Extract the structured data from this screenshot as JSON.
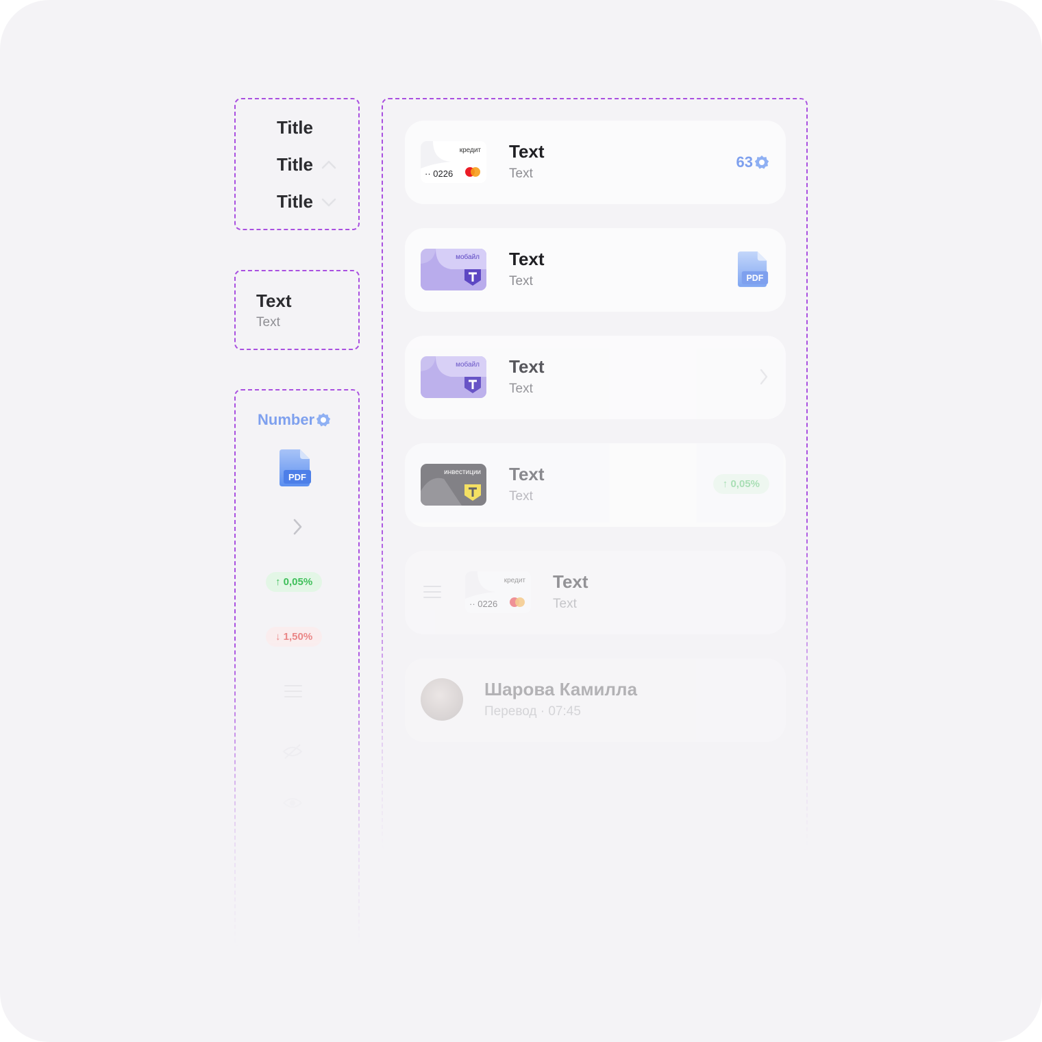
{
  "titles_box": {
    "rows": [
      {
        "label": "Title"
      },
      {
        "label": "Title",
        "accessory": "chevron-up-icon"
      },
      {
        "label": "Title",
        "accessory": "chevron-down-icon"
      }
    ]
  },
  "text_box": {
    "title": "Text",
    "subtitle": "Text"
  },
  "accessories_box": {
    "number_label": "Number",
    "pdf_label": "PDF",
    "badge_up": "↑ 0,05%",
    "badge_down": "↓ 1,50%",
    "icons": [
      "verified-icon",
      "pdf-file-icon",
      "chevron-right-icon",
      "menu-lines-icon",
      "eye-off-icon",
      "eye-icon"
    ]
  },
  "list": {
    "cards": [
      {
        "thumb": {
          "type": "credit",
          "label": "кредит",
          "number": "·· 0226"
        },
        "title": "Text",
        "subtitle": "Text",
        "accessory": {
          "type": "number",
          "value": "63"
        }
      },
      {
        "thumb": {
          "type": "mobile",
          "label": "мобайл",
          "letter": "T"
        },
        "title": "Text",
        "subtitle": "Text",
        "accessory": {
          "type": "pdf",
          "value": "PDF"
        }
      },
      {
        "thumb": {
          "type": "mobile",
          "label": "мобайл",
          "letter": "T"
        },
        "title": "Text",
        "subtitle": "Text",
        "accessory": {
          "type": "chevron"
        }
      },
      {
        "thumb": {
          "type": "invest",
          "label": "инвестиции",
          "letter": "T"
        },
        "title": "Text",
        "subtitle": "Text",
        "accessory": {
          "type": "badge",
          "value": "↑ 0,05%"
        }
      },
      {
        "thumb": {
          "type": "credit",
          "label": "кредит",
          "number": "·· 0226"
        },
        "title": "Text",
        "subtitle": "Text",
        "accessory": {
          "type": "drag-handle"
        }
      },
      {
        "thumb": {
          "type": "avatar"
        },
        "title": "Шарова Камилла",
        "subtitle": "Перевод · 07:45"
      }
    ]
  },
  "colors": {
    "canvas": "#f4f3f6",
    "dashed_border": "#a94fe0",
    "card": "#fbfbfc",
    "accent_blue": "#7ea0ee",
    "mobile_purple": "#c7bdf0",
    "t_shield": "#5d47c3",
    "invest_gray": "#6f6e73",
    "invest_yellow": "#f5dd4a",
    "up_green": "#3fbf5a",
    "down_red": "#e86b6b"
  }
}
